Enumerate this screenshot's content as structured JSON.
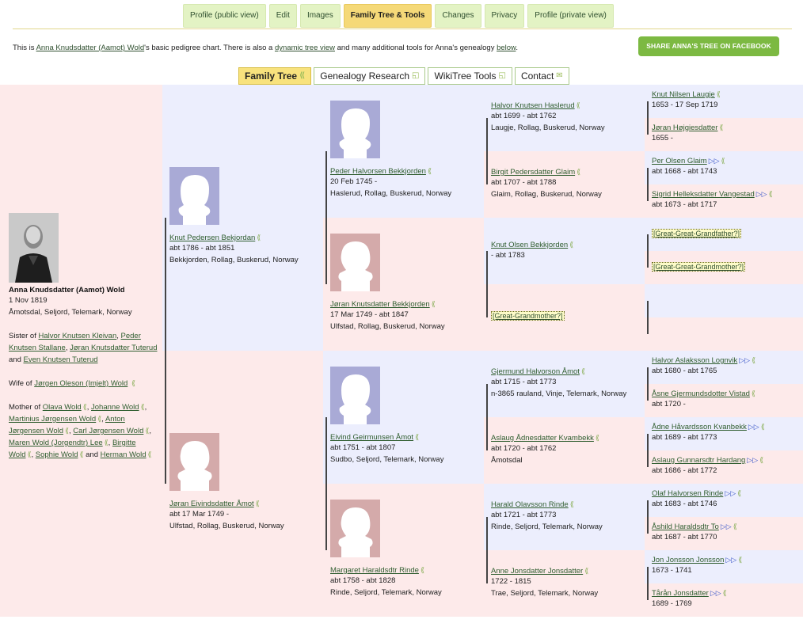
{
  "tabs": [
    {
      "label": "Profile (public view)",
      "active": false
    },
    {
      "label": "Edit",
      "active": false
    },
    {
      "label": "Images",
      "active": false
    },
    {
      "label": "Family Tree & Tools",
      "active": true
    },
    {
      "label": "Changes",
      "active": false
    },
    {
      "label": "Privacy",
      "active": false
    },
    {
      "label": "Profile (private view)",
      "active": false
    }
  ],
  "intro": {
    "p1": "This is ",
    "name_link": "Anna Knudsdatter (Aamot) Wold",
    "p2": "'s basic pedigree chart. There is also a ",
    "dynamic_link": "dynamic tree view",
    "p3": " and many additional tools for Anna's genealogy ",
    "below_link": "below",
    "p4": "."
  },
  "share_button": "SHARE ANNA'S TREE ON FACEBOOK",
  "subtabs": [
    {
      "label": "Family Tree",
      "active": true,
      "icon": "tree-icon"
    },
    {
      "label": "Genealogy Research",
      "active": false,
      "icon": "window-icon"
    },
    {
      "label": "WikiTree Tools",
      "active": false,
      "icon": "window-icon"
    },
    {
      "label": "Contact",
      "active": false,
      "icon": "mail-icon"
    }
  ],
  "colors": {
    "male_bg": "#eceefd",
    "female_bg": "#fdeaea",
    "tab_bg": "#e3f3c4",
    "tab_active": "#f5d978",
    "fb_green": "#7cb942"
  },
  "root": {
    "name": "Anna Knudsdatter (Aamot) Wold",
    "date": "1 Nov 1819",
    "place": "Åmotsdal, Seljord, Telemark, Norway",
    "sister_prefix": "Sister of ",
    "siblings": [
      "Halvor Knutsen Kleivan",
      "Peder Knutsen Stallane",
      "Jøran Knutsdatter Tuterud",
      "Even Knutsen Tuterud"
    ],
    "sibling_sep1": ", ",
    "sibling_sep2": ", ",
    "sibling_and": " and ",
    "wife_prefix": "Wife of ",
    "spouse": "Jørgen Oleson (Imjelt) Wold",
    "mother_prefix": "Mother of ",
    "children": [
      "Olava Wold",
      "Johanne Wold",
      "Martinius Jørgensen Wold",
      "Anton Jørgensen Wold",
      "Carl Jørgensen Wold",
      "Maren Wold (Jorgendtr) Lee",
      "Birgitte Wold",
      "Sophie Wold",
      "Herman Wold"
    ],
    "child_and": "and"
  },
  "parents": [
    {
      "name": "Knut Pedersen Bekjordan",
      "date": "abt 1786 - abt 1851",
      "place": "Bekkjorden, Rollag, Buskerud, Norway"
    },
    {
      "name": "Jøran Eivindsdatter Åmot",
      "date": "abt 17 Mar 1749 -",
      "place": "Ulfstad, Rollag, Buskerud, Norway"
    }
  ],
  "grandparents": [
    {
      "name": "Peder Halvorsen Bekkjorden",
      "date": "20 Feb 1745 -",
      "place": "Haslerud, Rollag, Buskerud, Norway"
    },
    {
      "name": "Jøran Knutsdatter Bekkjorden",
      "date": "17 Mar 1749 - abt 1847",
      "place": "Ulfstad, Rollag, Buskerud, Norway"
    },
    {
      "name": "Eivind Geirmunsen Åmot",
      "date": "abt 1751 - abt 1807",
      "place": "Sudbo, Seljord, Telemark, Norway"
    },
    {
      "name": "Margaret Haraldsdtr Rinde",
      "date": "abt 1758 - abt 1828",
      "place": "Rinde, Seljord, Telemark, Norway"
    }
  ],
  "great_grandparents": [
    {
      "name": "Halvor Knutsen Haslerud",
      "date": "abt 1699 - abt 1762",
      "place": "Laugje, Rollag, Buskerud, Norway"
    },
    {
      "name": "Birgit Pedersdatter Glaim",
      "date": "abt 1707 - abt 1788",
      "place": "Glaim, Rollag, Buskerud, Norway"
    },
    {
      "name": "Knut Olsen Bekkjorden",
      "date": "- abt 1783",
      "place": ""
    },
    {
      "name": "[Great-Grandmother?]",
      "date": "",
      "place": "",
      "placeholder": true
    },
    {
      "name": "Gjermund Halvorson Åmot",
      "date": "abt 1715 - abt 1773",
      "place": "n-3865 rauland, Vinje, Telemark, Norway"
    },
    {
      "name": "Aslaug Ådnesdatter Kvambekk",
      "date": "abt 1720 - abt 1762",
      "place": "Åmotsdal"
    },
    {
      "name": "Harald Olavsson Rinde",
      "date": "abt 1721 - abt 1773",
      "place": "Rinde, Seljord, Telemark, Norway"
    },
    {
      "name": "Anne Jonsdatter Jonsdatter",
      "date": "1722 - 1815",
      "place": "Trae, Seljord, Telemark, Norway"
    }
  ],
  "gg_grandparents": [
    {
      "name": "Knut Nilsen Laugje",
      "date": "1653 - 17 Sep 1719",
      "dna": false
    },
    {
      "name": "Jøran Højgiesdatter",
      "date": "1655 -",
      "dna": false
    },
    {
      "name": "Per Olsen Glaim",
      "date": "abt 1668 - abt 1743",
      "dna": true
    },
    {
      "name": "Sigrid Helleksdatter Vangestad",
      "date": "abt 1673 - abt 1717",
      "dna": true
    },
    {
      "name": "[Great-Great-Grandfather?]",
      "date": "",
      "placeholder": true
    },
    {
      "name": "[Great-Great-Grandmother?]",
      "date": "",
      "placeholder": true
    },
    {
      "name": "",
      "date": "",
      "empty": true
    },
    {
      "name": "",
      "date": "",
      "empty": true
    },
    {
      "name": "Halvor Aslaksson Lognvik",
      "date": "abt 1680 - abt 1765",
      "dna": true
    },
    {
      "name": "Åsne Gjermundsdotter Vistad",
      "date": "abt 1720 -",
      "dna": false
    },
    {
      "name": "Ådne Håvardsson Kvanbekk",
      "date": "abt 1689 - abt 1773",
      "dna": true
    },
    {
      "name": "Aslaug Gunnarsdtr Hardang",
      "date": "abt 1686 - abt 1772",
      "dna": true
    },
    {
      "name": "Olaf Halvorsen Rinde",
      "date": "abt 1683 - abt 1746",
      "dna": true
    },
    {
      "name": "Åshild Haraldsdtr To",
      "date": "abt 1687 - abt 1770",
      "dna": true
    },
    {
      "name": "Jon Jonsson Jonsson",
      "date": "1673 - 1741",
      "dna": true
    },
    {
      "name": "Tårån Jonsdatter",
      "date": "1689 - 1769",
      "dna": true
    }
  ]
}
